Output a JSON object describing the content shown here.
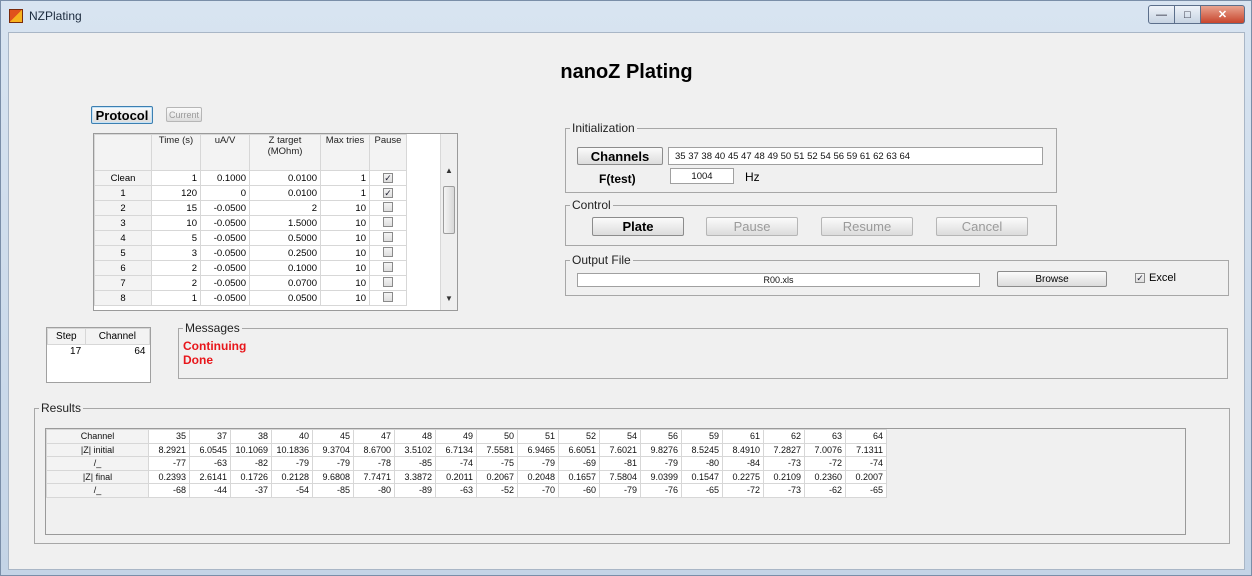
{
  "window": {
    "title": "NZPlating"
  },
  "heading": "nanoZ Plating",
  "buttons": {
    "protocol": "Protocol",
    "current": "Current"
  },
  "protocol": {
    "columns": [
      "Time (s)",
      "uA/V",
      "Z target (MOhm)",
      "Max tries",
      "Pause"
    ],
    "rows": [
      {
        "label": "Clean",
        "time": "1",
        "uav": "0.1000",
        "z": "0.0100",
        "tries": "1",
        "pause": true
      },
      {
        "label": "1",
        "time": "120",
        "uav": "0",
        "z": "0.0100",
        "tries": "1",
        "pause": true
      },
      {
        "label": "2",
        "time": "15",
        "uav": "-0.0500",
        "z": "2",
        "tries": "10",
        "pause": false
      },
      {
        "label": "3",
        "time": "10",
        "uav": "-0.0500",
        "z": "1.5000",
        "tries": "10",
        "pause": false
      },
      {
        "label": "4",
        "time": "5",
        "uav": "-0.0500",
        "z": "0.5000",
        "tries": "10",
        "pause": false
      },
      {
        "label": "5",
        "time": "3",
        "uav": "-0.0500",
        "z": "0.2500",
        "tries": "10",
        "pause": false
      },
      {
        "label": "6",
        "time": "2",
        "uav": "-0.0500",
        "z": "0.1000",
        "tries": "10",
        "pause": false
      },
      {
        "label": "7",
        "time": "2",
        "uav": "-0.0500",
        "z": "0.0700",
        "tries": "10",
        "pause": false
      },
      {
        "label": "8",
        "time": "1",
        "uav": "-0.0500",
        "z": "0.0500",
        "tries": "10",
        "pause": false
      }
    ]
  },
  "initialization": {
    "legend": "Initialization",
    "channels_button": "Channels",
    "channels_value": "35 37 38 40 45 47 48 49 50 51 52 54 56 59 61 62 63 64",
    "ftest_label": "F(test)",
    "ftest_value": "1004",
    "ftest_unit": "Hz"
  },
  "control": {
    "legend": "Control",
    "plate": "Plate",
    "pause": "Pause",
    "resume": "Resume",
    "cancel": "Cancel"
  },
  "output": {
    "legend": "Output File",
    "filename": "R00.xls",
    "browse": "Browse",
    "excel_label": "Excel",
    "excel_checked": true
  },
  "step": {
    "headers": [
      "Step",
      "Channel"
    ],
    "step": "17",
    "channel": "64"
  },
  "messages": {
    "legend": "Messages",
    "lines": [
      "Continuing",
      "Done"
    ],
    "color": "#e8161b"
  },
  "results": {
    "legend": "Results",
    "rows": [
      {
        "label": "Channel",
        "values": [
          "35",
          "37",
          "38",
          "40",
          "45",
          "47",
          "48",
          "49",
          "50",
          "51",
          "52",
          "54",
          "56",
          "59",
          "61",
          "62",
          "63",
          "64"
        ]
      },
      {
        "label": "|Z| initial",
        "values": [
          "8.2921",
          "6.0545",
          "10.1069",
          "10.1836",
          "9.3704",
          "8.6700",
          "3.5102",
          "6.7134",
          "7.5581",
          "6.9465",
          "6.6051",
          "7.6021",
          "9.8276",
          "8.5245",
          "8.4910",
          "7.2827",
          "7.0076",
          "7.1311"
        ]
      },
      {
        "label": "/_",
        "values": [
          "-77",
          "-63",
          "-82",
          "-79",
          "-79",
          "-78",
          "-85",
          "-74",
          "-75",
          "-79",
          "-69",
          "-81",
          "-79",
          "-80",
          "-84",
          "-73",
          "-72",
          "-74"
        ]
      },
      {
        "label": "|Z| final",
        "values": [
          "0.2393",
          "2.6141",
          "0.1726",
          "0.2128",
          "9.6808",
          "7.7471",
          "3.3872",
          "0.2011",
          "0.2067",
          "0.2048",
          "0.1657",
          "7.5804",
          "9.0399",
          "0.1547",
          "0.2275",
          "0.2109",
          "0.2360",
          "0.2007"
        ]
      },
      {
        "label": "/_",
        "values": [
          "-68",
          "-44",
          "-37",
          "-54",
          "-85",
          "-80",
          "-89",
          "-63",
          "-52",
          "-70",
          "-60",
          "-79",
          "-76",
          "-65",
          "-72",
          "-73",
          "-62",
          "-65"
        ]
      }
    ]
  }
}
